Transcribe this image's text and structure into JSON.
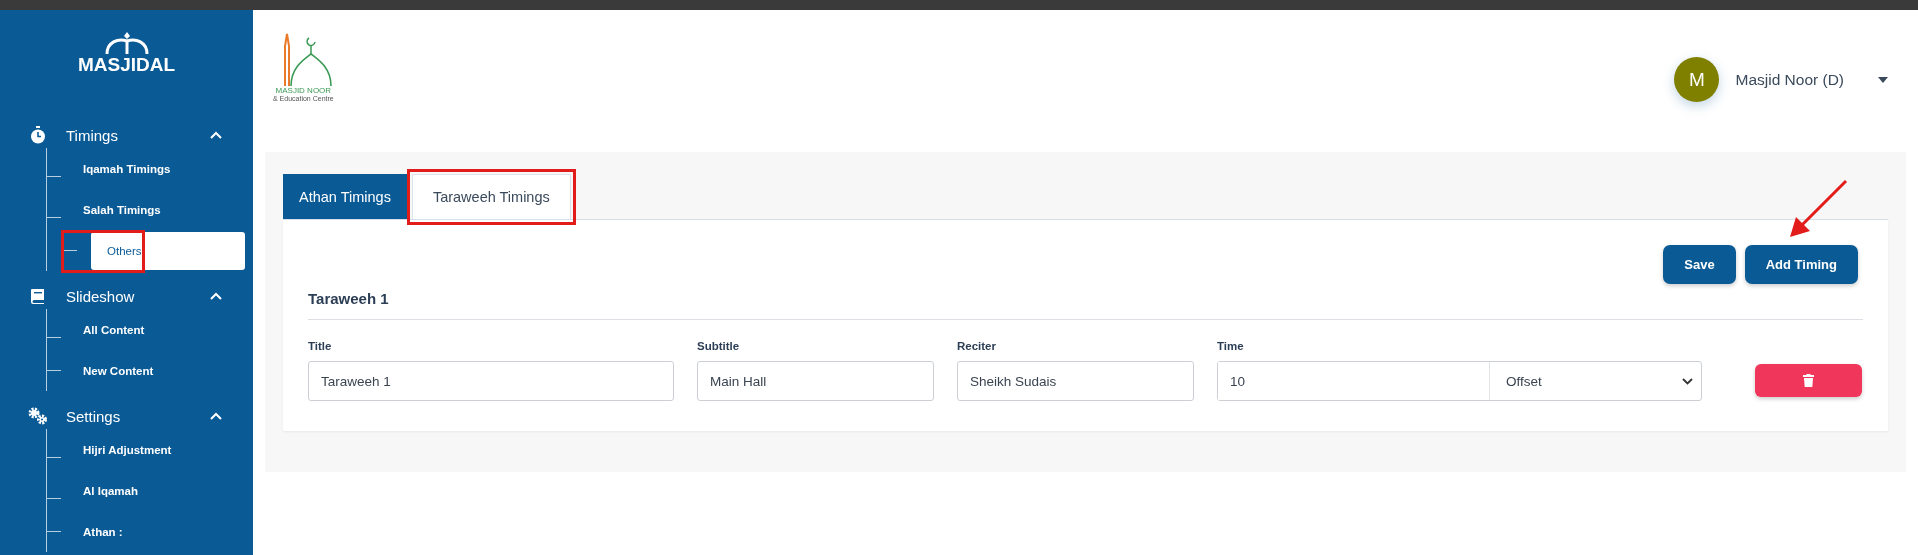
{
  "sidebar": {
    "logo": "MASJIDAL",
    "groups": [
      {
        "label": "Timings",
        "expanded": true,
        "items": [
          {
            "label": "Iqamah Timings",
            "selected": false,
            "highlighted": false
          },
          {
            "label": "Salah Timings",
            "selected": false,
            "highlighted": false
          },
          {
            "label": "Others",
            "selected": true,
            "highlighted": true
          }
        ]
      },
      {
        "label": "Slideshow",
        "expanded": true,
        "items": [
          {
            "label": "All Content",
            "selected": false,
            "highlighted": false
          },
          {
            "label": "New Content",
            "selected": false,
            "highlighted": false
          }
        ]
      },
      {
        "label": "Settings",
        "expanded": true,
        "items": [
          {
            "label": "Hijri Adjustment",
            "selected": false,
            "highlighted": false
          },
          {
            "label": "Al Iqamah",
            "selected": false,
            "highlighted": false
          },
          {
            "label": "Athan :",
            "selected": false,
            "highlighted": false
          }
        ]
      }
    ]
  },
  "header": {
    "org_logo": {
      "name": "MASJID NOOR",
      "tagline": "& Education Centre"
    },
    "user": {
      "initial": "M",
      "name": "Masjid Noor (D)"
    }
  },
  "tabs": [
    {
      "label": "Athan Timings",
      "selected": false,
      "highlighted": false
    },
    {
      "label": "Taraweeh Timings",
      "selected": true,
      "highlighted": true
    }
  ],
  "buttons": [
    {
      "label": "Save",
      "arrow": false
    },
    {
      "label": "Add Timing",
      "arrow": true
    }
  ],
  "section_title": "Taraweeh 1",
  "form": {
    "title": {
      "label": "Title",
      "value": "Taraweeh 1"
    },
    "subtitle": {
      "label": "Subtitle",
      "value": "Main Hall"
    },
    "reciter": {
      "label": "Reciter",
      "value": "Sheikh Sudais"
    },
    "time": {
      "label": "Time",
      "value": "10",
      "mode": "Offset"
    }
  }
}
